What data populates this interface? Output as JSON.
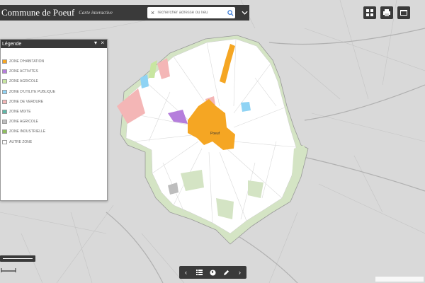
{
  "header": {
    "title": "Commune de Poeuf",
    "subtitle": "Carte interactive",
    "search_placeholder": "rechercher adresse ou lieu"
  },
  "legend": {
    "title": "Légende",
    "layer_title": "",
    "items": [
      {
        "label": "ZONE D'HABITATION",
        "color": "#f5a623"
      },
      {
        "label": "ZONE ACTIVITES",
        "color": "#b57edc"
      },
      {
        "label": "ZONE AGRICOLE",
        "color": "#c8e6a0"
      },
      {
        "label": "ZONE D'UTILITE PUBLIQUE",
        "color": "#8fd3f4"
      },
      {
        "label": "ZONE DE VERDURE",
        "color": "#f4b6b6"
      },
      {
        "label": "ZONE MIXTE",
        "color": "#5fb8a8"
      },
      {
        "label": "ZONE AGRICOLE",
        "color": "#bdbdbd"
      },
      {
        "label": "ZONE INDUSTRIELLE",
        "color": "#8fbf5f"
      },
      {
        "label": "AUTRE ZONE",
        "color": "#ffffff"
      }
    ]
  },
  "map": {
    "place_label": "Poeuf",
    "region_label": "",
    "colors": {
      "habitation": "#f5a623",
      "agricole": "#ffffff",
      "verdure": "#d4e4c4",
      "activites": "#b57edc",
      "publique": "#8fd3f4",
      "rose": "#f4b6b6",
      "background": "#d9d9d9"
    }
  }
}
